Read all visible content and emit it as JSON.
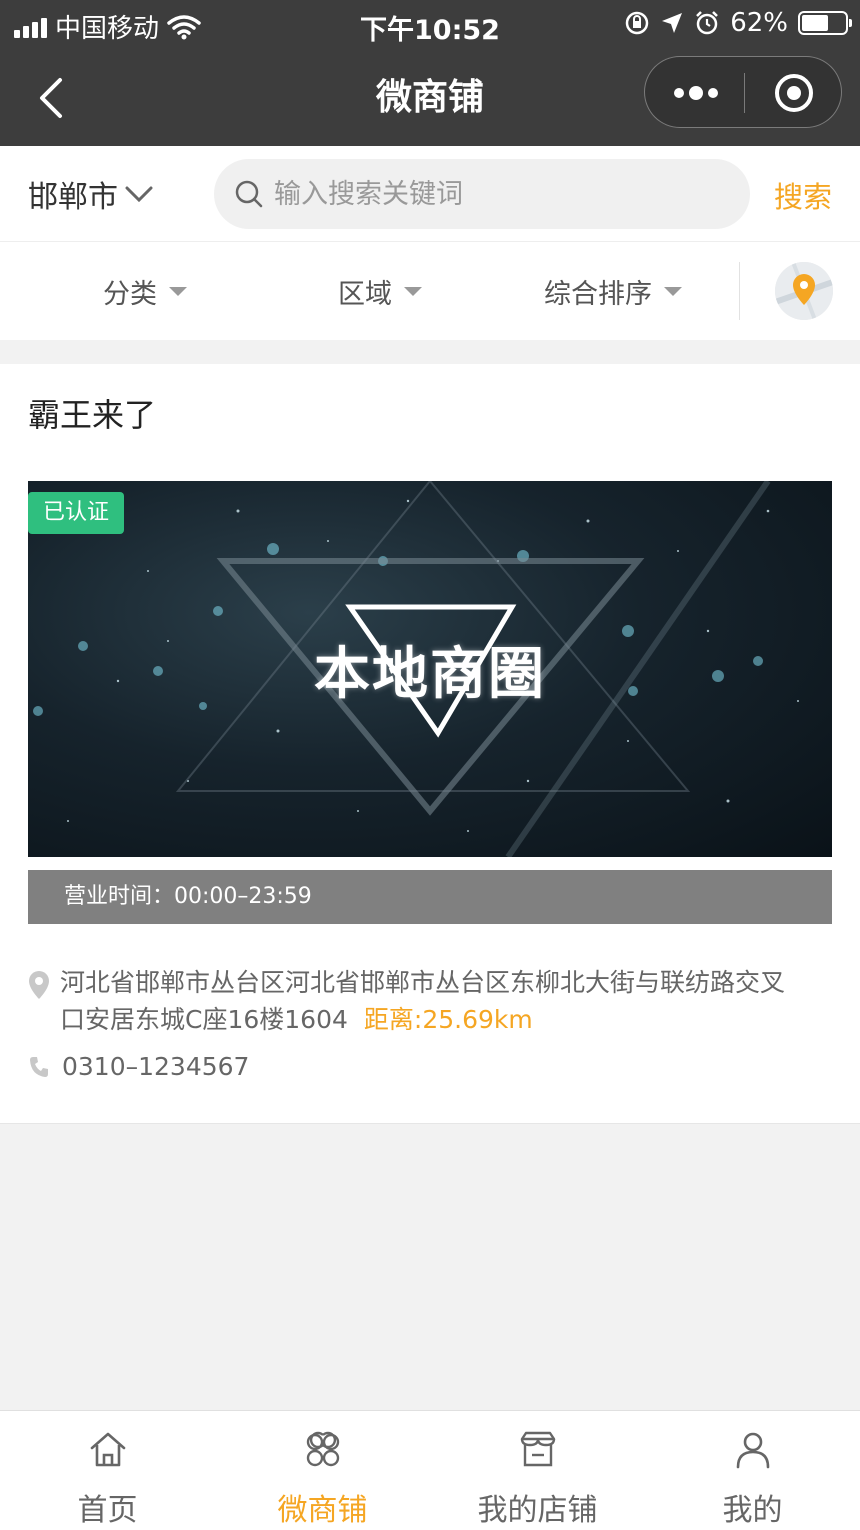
{
  "status_bar": {
    "carrier": "中国移动",
    "time": "下午10:52",
    "battery_percent": "62%",
    "battery_level": 0.62
  },
  "nav": {
    "title": "微商铺",
    "back_icon": "chevron-left-icon",
    "more_icon": "more-dots-icon",
    "close_icon": "target-close-icon"
  },
  "search": {
    "city": "邯郸市",
    "placeholder": "输入搜索关键词",
    "value": "",
    "button_label": "搜索"
  },
  "filters": [
    {
      "label": "分类"
    },
    {
      "label": "区域"
    },
    {
      "label": "综合排序"
    }
  ],
  "shop": {
    "name": "霸王来了",
    "badge": "已认证",
    "banner_text": "本地商圈",
    "hours": "营业时间：00:00–23:59",
    "address": "河北省邯郸市丛台区河北省邯郸市丛台区东柳北大街与联纺路交叉口安居东城C座16楼1604",
    "distance": "距离:25.69km",
    "phone": "0310–1234567"
  },
  "tabs": [
    {
      "label": "首页",
      "icon": "home-icon"
    },
    {
      "label": "微商铺",
      "icon": "clover-icon",
      "active": true
    },
    {
      "label": "我的店铺",
      "icon": "store-icon"
    },
    {
      "label": "我的",
      "icon": "user-icon"
    }
  ],
  "colors": {
    "accent": "#f5a623",
    "nav_bg": "#3d3d3d",
    "badge": "#2fbf7f",
    "hours_bar": "#808080"
  }
}
